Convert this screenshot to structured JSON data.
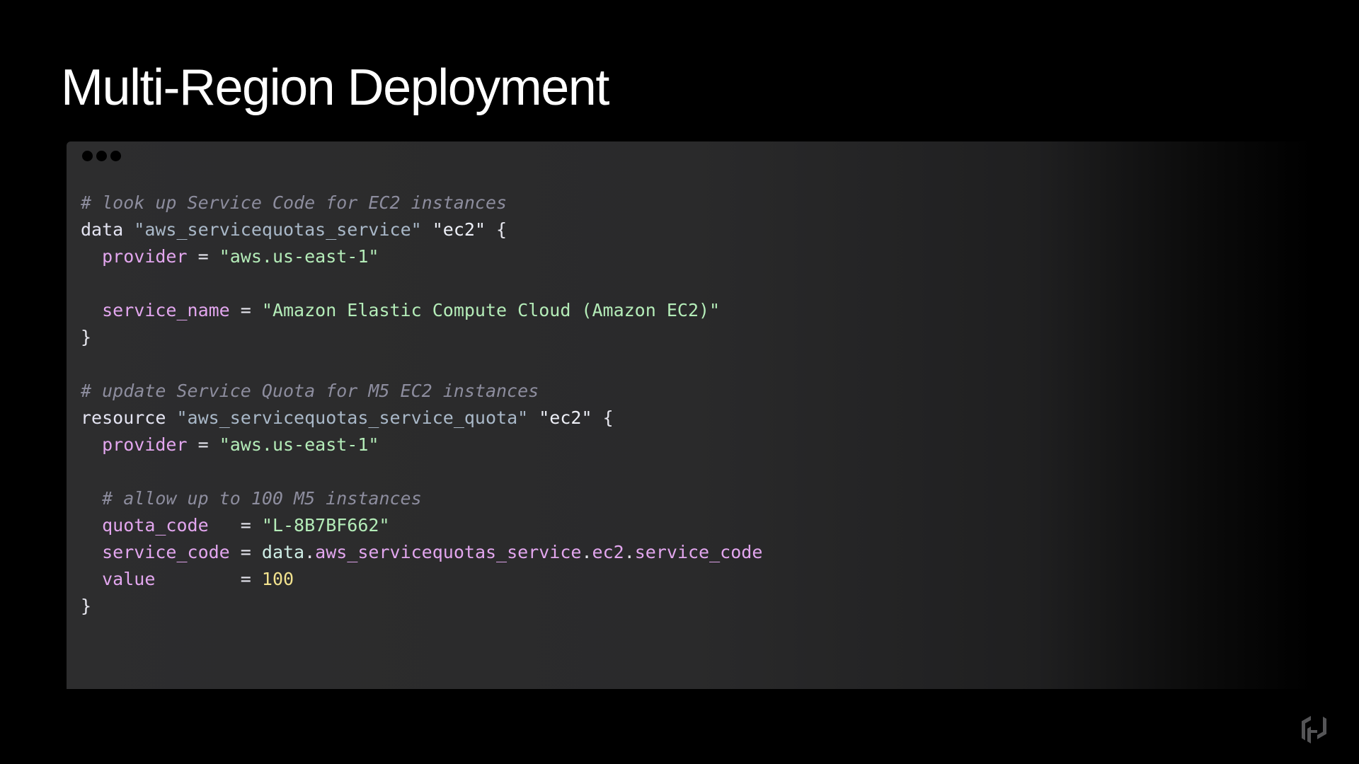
{
  "slide": {
    "title": "Multi-Region Deployment"
  },
  "code_window": {
    "lines": [
      [
        {
          "t": "# look up Service Code for EC2 instances",
          "c": "comment"
        }
      ],
      [
        {
          "t": "data",
          "c": "kw"
        },
        {
          "t": " ",
          "c": "punct"
        },
        {
          "t": "\"aws_servicequotas_service\"",
          "c": "type"
        },
        {
          "t": " ",
          "c": "punct"
        },
        {
          "t": "\"ec2\"",
          "c": "name"
        },
        {
          "t": " {",
          "c": "punct"
        }
      ],
      [
        {
          "t": "  ",
          "c": "punct"
        },
        {
          "t": "provider",
          "c": "attr"
        },
        {
          "t": " = ",
          "c": "op"
        },
        {
          "t": "\"aws.us-east-1\"",
          "c": "str"
        }
      ],
      [],
      [
        {
          "t": "  ",
          "c": "punct"
        },
        {
          "t": "service_name",
          "c": "attr"
        },
        {
          "t": " = ",
          "c": "op"
        },
        {
          "t": "\"Amazon Elastic Compute Cloud (Amazon EC2)\"",
          "c": "str"
        }
      ],
      [
        {
          "t": "}",
          "c": "punct"
        }
      ],
      [],
      [
        {
          "t": "# update Service Quota for M5 EC2 instances",
          "c": "comment"
        }
      ],
      [
        {
          "t": "resource",
          "c": "kw"
        },
        {
          "t": " ",
          "c": "punct"
        },
        {
          "t": "\"aws_servicequotas_service_quota\"",
          "c": "type"
        },
        {
          "t": " ",
          "c": "punct"
        },
        {
          "t": "\"ec2\"",
          "c": "name"
        },
        {
          "t": " {",
          "c": "punct"
        }
      ],
      [
        {
          "t": "  ",
          "c": "punct"
        },
        {
          "t": "provider",
          "c": "attr"
        },
        {
          "t": " = ",
          "c": "op"
        },
        {
          "t": "\"aws.us-east-1\"",
          "c": "str"
        }
      ],
      [],
      [
        {
          "t": "  ",
          "c": "punct"
        },
        {
          "t": "# allow up to 100 M5 instances",
          "c": "comment"
        }
      ],
      [
        {
          "t": "  ",
          "c": "punct"
        },
        {
          "t": "quota_code",
          "c": "attr"
        },
        {
          "t": "   = ",
          "c": "op"
        },
        {
          "t": "\"L-8B7BF662\"",
          "c": "str"
        }
      ],
      [
        {
          "t": "  ",
          "c": "punct"
        },
        {
          "t": "service_code",
          "c": "attr"
        },
        {
          "t": " = ",
          "c": "op"
        },
        {
          "t": "data",
          "c": "ref"
        },
        {
          "t": ".",
          "c": "punct"
        },
        {
          "t": "aws_servicequotas_service",
          "c": "attr"
        },
        {
          "t": ".",
          "c": "punct"
        },
        {
          "t": "ec2",
          "c": "attr"
        },
        {
          "t": ".",
          "c": "punct"
        },
        {
          "t": "service_code",
          "c": "attr"
        }
      ],
      [
        {
          "t": "  ",
          "c": "punct"
        },
        {
          "t": "value",
          "c": "attr"
        },
        {
          "t": "        = ",
          "c": "op"
        },
        {
          "t": "100",
          "c": "num"
        }
      ],
      [
        {
          "t": "}",
          "c": "punct"
        }
      ]
    ]
  },
  "logo": {
    "icon": "hashicorp-logo-icon"
  }
}
